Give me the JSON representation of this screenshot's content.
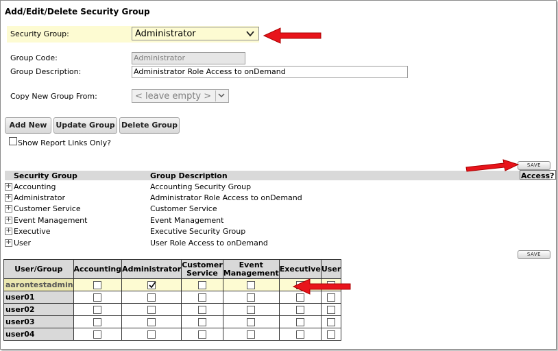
{
  "page": {
    "title": "Add/Edit/Delete Security Group"
  },
  "form": {
    "security_group_label": "Security Group:",
    "security_group_value": "Administrator",
    "group_code_label": "Group Code:",
    "group_code_value": "Administrator",
    "group_description_label": "Group Description:",
    "group_description_value": "Administrator Role Access to onDemand",
    "copy_from_label": "Copy New Group From:",
    "copy_from_value": "< leave empty >"
  },
  "buttons": {
    "add_new": "Add New",
    "update_group": "Update Group",
    "delete_group": "Delete Group",
    "save": "SAVE"
  },
  "report_links": {
    "label": "Show Report Links Only?",
    "checked": false
  },
  "groups_table": {
    "headers": [
      "Security Group",
      "Group Description",
      "Access?"
    ],
    "rows": [
      {
        "name": "Accounting",
        "description": "Accounting Security Group"
      },
      {
        "name": "Administrator",
        "description": "Administrator Role Access to onDemand"
      },
      {
        "name": "Customer Service",
        "description": "Customer Service"
      },
      {
        "name": "Event Management",
        "description": "Event Management"
      },
      {
        "name": "Executive",
        "description": "Executive Security Group"
      },
      {
        "name": "User",
        "description": "User Role Access to onDemand"
      }
    ]
  },
  "user_grid": {
    "corner": "User/Group",
    "columns": [
      "Accounting",
      "Administrator",
      "Customer Service",
      "Event Management",
      "Executive",
      "User"
    ],
    "rows": [
      {
        "user": "aarontestadmin",
        "checks": [
          false,
          true,
          false,
          false,
          false,
          false
        ],
        "highlight": true
      },
      {
        "user": "user01",
        "checks": [
          false,
          false,
          false,
          false,
          false,
          false
        ],
        "highlight": false
      },
      {
        "user": "user02",
        "checks": [
          false,
          false,
          false,
          false,
          false,
          false
        ],
        "highlight": false
      },
      {
        "user": "user03",
        "checks": [
          false,
          false,
          false,
          false,
          false,
          false
        ],
        "highlight": false
      },
      {
        "user": "user04",
        "checks": [
          false,
          false,
          false,
          false,
          false,
          false
        ],
        "highlight": false
      }
    ]
  },
  "colors": {
    "highlight": "#fdfbd2",
    "header_gray": "#d9d9d9",
    "arrow_red": "#e8141b"
  },
  "icons": {
    "dropdown": "chevron-down-icon",
    "expand": "plus-icon",
    "pointer": "red-arrow-icon",
    "check": "check-icon"
  }
}
